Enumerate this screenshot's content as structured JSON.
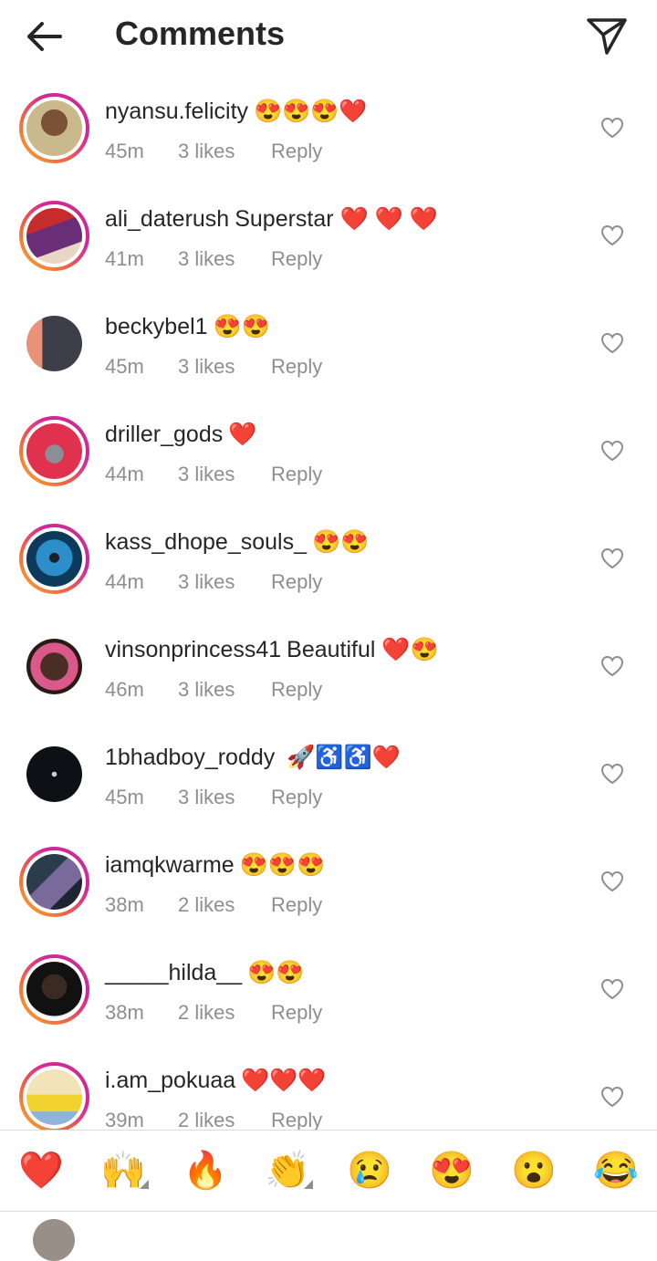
{
  "header": {
    "title": "Comments"
  },
  "comments": [
    {
      "username": "nyansu.felicity",
      "text": "",
      "emoji": "😍😍😍❤️",
      "time": "45m",
      "likes": "3 likes",
      "reply": "Reply"
    },
    {
      "username": "ali_daterush",
      "text": "Superstar",
      "emoji": "❤️ ❤️ ❤️",
      "time": "41m",
      "likes": "3 likes",
      "reply": "Reply"
    },
    {
      "username": "beckybel1",
      "text": "",
      "emoji": "😍😍",
      "time": "45m",
      "likes": "3 likes",
      "reply": "Reply"
    },
    {
      "username": "driller_gods",
      "text": "",
      "emoji": "❤️",
      "time": "44m",
      "likes": "3 likes",
      "reply": "Reply"
    },
    {
      "username": "kass_dhope_souls_",
      "text": "",
      "emoji": "😍😍",
      "time": "44m",
      "likes": "3 likes",
      "reply": "Reply"
    },
    {
      "username": "vinsonprincess41",
      "text": "Beautiful",
      "emoji": "❤️😍",
      "time": "46m",
      "likes": "3 likes",
      "reply": "Reply"
    },
    {
      "username": "1bhadboy_roddy",
      "text": "",
      "emoji": "🚀♿♿❤️",
      "time": "45m",
      "likes": "3 likes",
      "reply": "Reply"
    },
    {
      "username": "iamqkwarme",
      "text": "",
      "emoji": "😍😍😍",
      "time": "38m",
      "likes": "2 likes",
      "reply": "Reply"
    },
    {
      "username": "_____hilda__",
      "text": "",
      "emoji": "😍😍",
      "time": "38m",
      "likes": "2 likes",
      "reply": "Reply"
    },
    {
      "username": "i.am_pokuaa",
      "text": "",
      "emoji": "❤️❤️❤️",
      "time": "39m",
      "likes": "2 likes",
      "reply": "Reply"
    }
  ],
  "reactions": [
    "❤️",
    "🙌",
    "🔥",
    "👏",
    "😢",
    "😍",
    "😮",
    "😂"
  ]
}
